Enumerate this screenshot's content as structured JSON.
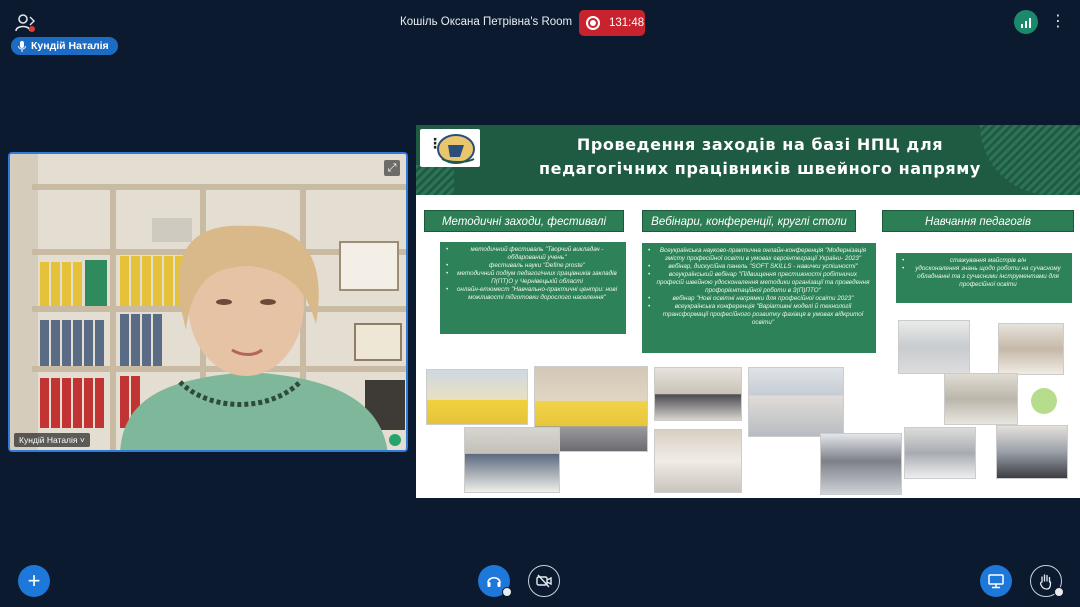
{
  "header": {
    "room_title": "Кошіль Оксана Петрівна's Room",
    "recording_time": "131:48",
    "active_speaker": "Кундій Наталія"
  },
  "video_tile": {
    "name_label": "Кундій Наталія ˅"
  },
  "slide": {
    "title_line1": "Проведення заходів на базі НПЦ для",
    "title_line2": "педагогічних працівників швейного напряму",
    "columns": [
      {
        "heading": "Методичні заходи, фестивалі",
        "items": [
          "методичний фестиваль \"Творчий викладач - обдарований учень\"",
          "фестиваль науки \"Define proste\"",
          "методичний подіум педагогічних працівників закладів П(ПТ)О у Чернівецькій області",
          "онлайн-етюмест \"Навчально-практичні центри: нові можливості підготовки дорослого населення\""
        ]
      },
      {
        "heading": "Вебінари, конференції, круглі столи",
        "items": [
          "Всеукраїнська науково-практична онлайн-конференція \"Модернізація змісту професійної освіти в умовах євроінтеграції України- 2023\"",
          "вебінар, дискусійна панель \"SOFT SKILLS - навички успішності\"",
          "всеукраїнський вебінар \"Підвищення престижності робітничих професій швейною удосконалення методики організації та проведення профорієнтаційної роботи в З(П)ПТО\"",
          "вебінар \"Нові освітні напрямки для професійної освіти 2023\"",
          "всеукраїнська конференція \"Варіативні моделі й технології трансформації професійного розвитку фахівця в умовах відкритої освіти\""
        ]
      },
      {
        "heading": "Навчання педагогів",
        "items": [
          "стажування майстрів в/н",
          "удосконалення знань щодо роботи на сучасному обладнанні та з сучасними інструментами для професійної освіти"
        ]
      }
    ]
  },
  "icons": {
    "participants": "participants-icon",
    "mic": "mic-icon",
    "add": "plus-icon",
    "audio": "headphones-icon",
    "video": "camera-off-icon",
    "share": "screen-share-icon",
    "hand": "raise-hand-icon"
  },
  "colors": {
    "background": "#0b1a2e",
    "accent": "#1e78d9",
    "record": "#c8232c",
    "slide_green": "#1f5a43"
  }
}
